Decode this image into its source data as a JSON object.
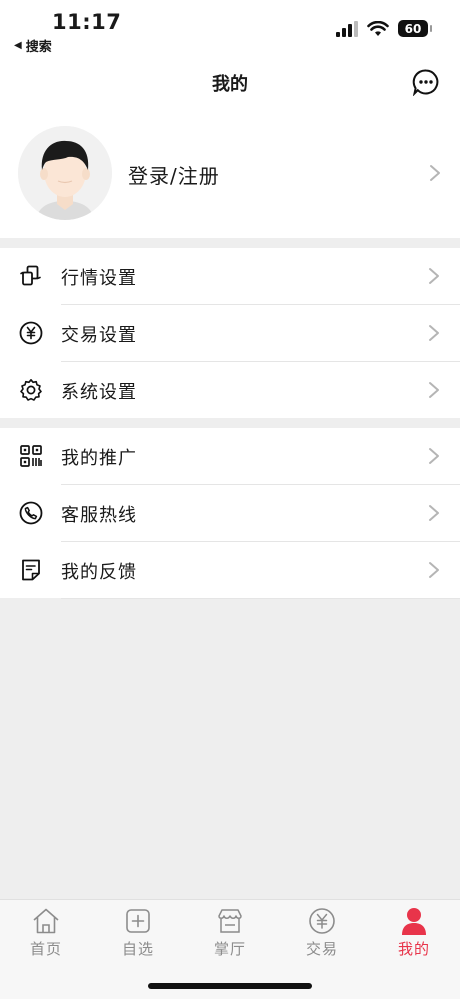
{
  "status_bar": {
    "time": "11:17",
    "back_app": "搜索",
    "battery": "60"
  },
  "nav": {
    "title": "我的"
  },
  "profile": {
    "login_label": "登录/注册"
  },
  "menu_groups": [
    {
      "items": [
        {
          "label": "行情设置",
          "icon": "quotes-settings-icon"
        },
        {
          "label": "交易设置",
          "icon": "yen-circle-icon"
        },
        {
          "label": "系统设置",
          "icon": "gear-icon"
        }
      ]
    },
    {
      "items": [
        {
          "label": "我的推广",
          "icon": "qr-code-icon"
        },
        {
          "label": "客服热线",
          "icon": "phone-icon"
        },
        {
          "label": "我的反馈",
          "icon": "feedback-note-icon"
        }
      ]
    }
  ],
  "tabs": [
    {
      "label": "首页",
      "icon": "home-icon"
    },
    {
      "label": "自选",
      "icon": "plus-square-icon"
    },
    {
      "label": "掌厅",
      "icon": "shop-icon"
    },
    {
      "label": "交易",
      "icon": "yen-circle-icon"
    },
    {
      "label": "我的",
      "icon": "person-icon",
      "active": true
    }
  ],
  "colors": {
    "accent": "#e8344a",
    "background": "#eeeeee",
    "tab_inactive": "#8c8c8c"
  }
}
